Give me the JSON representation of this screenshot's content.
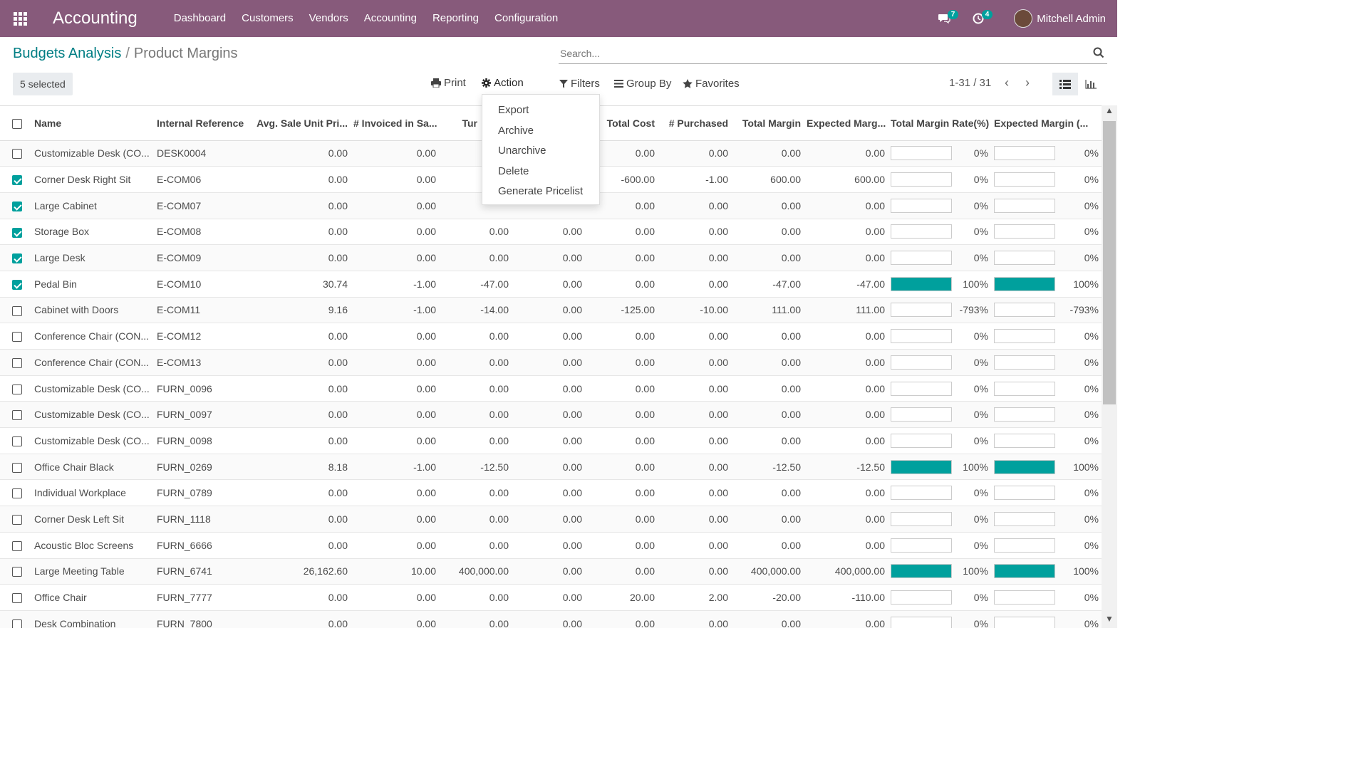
{
  "topbar": {
    "app_title": "Accounting",
    "menu": [
      "Dashboard",
      "Customers",
      "Vendors",
      "Accounting",
      "Reporting",
      "Configuration"
    ],
    "messages_count": "7",
    "activities_count": "4",
    "user_name": "Mitchell Admin"
  },
  "breadcrumb": {
    "parent": "Budgets Analysis",
    "separator": "/",
    "current": "Product Margins"
  },
  "search": {
    "placeholder": "Search..."
  },
  "toolbar": {
    "selected": "5 selected",
    "print": "Print",
    "action": "Action",
    "filters": "Filters",
    "group_by": "Group By",
    "favorites": "Favorites",
    "pager": "1-31 / 31",
    "pager_prev": "‹",
    "pager_next": "›"
  },
  "action_menu": [
    "Export",
    "Archive",
    "Unarchive",
    "Delete",
    "Generate Pricelist"
  ],
  "table": {
    "headers": [
      "Name",
      "Internal Reference",
      "Avg. Sale Unit Pri...",
      "# Invoiced in Sa...",
      "Tur",
      "",
      "Total Cost",
      "# Purchased",
      "Total Margin",
      "Expected Marg...",
      "Total Margin Rate(%)",
      "Expected Margin (..."
    ],
    "rows": [
      {
        "checked": false,
        "name": "Customizable Desk (CO...",
        "ref": "DESK0004",
        "avg": "0.00",
        "inv": "0.00",
        "tur": "",
        "c6": "",
        "cost": "0.00",
        "purch": "0.00",
        "margin": "0.00",
        "exp": "0.00",
        "rate": "0%",
        "rate_fill": 0,
        "exp_rate": "0%",
        "exp_fill": 0
      },
      {
        "checked": true,
        "name": "Corner Desk Right Sit",
        "ref": "E-COM06",
        "avg": "0.00",
        "inv": "0.00",
        "tur": "",
        "c6": "",
        "cost": "-600.00",
        "purch": "-1.00",
        "margin": "600.00",
        "exp": "600.00",
        "rate": "0%",
        "rate_fill": 0,
        "exp_rate": "0%",
        "exp_fill": 0
      },
      {
        "checked": true,
        "name": "Large Cabinet",
        "ref": "E-COM07",
        "avg": "0.00",
        "inv": "0.00",
        "tur": "",
        "c6": "",
        "cost": "0.00",
        "purch": "0.00",
        "margin": "0.00",
        "exp": "0.00",
        "rate": "0%",
        "rate_fill": 0,
        "exp_rate": "0%",
        "exp_fill": 0
      },
      {
        "checked": true,
        "name": "Storage Box",
        "ref": "E-COM08",
        "avg": "0.00",
        "inv": "0.00",
        "tur": "0.00",
        "c6": "0.00",
        "cost": "0.00",
        "purch": "0.00",
        "margin": "0.00",
        "exp": "0.00",
        "rate": "0%",
        "rate_fill": 0,
        "exp_rate": "0%",
        "exp_fill": 0
      },
      {
        "checked": true,
        "name": "Large Desk",
        "ref": "E-COM09",
        "avg": "0.00",
        "inv": "0.00",
        "tur": "0.00",
        "c6": "0.00",
        "cost": "0.00",
        "purch": "0.00",
        "margin": "0.00",
        "exp": "0.00",
        "rate": "0%",
        "rate_fill": 0,
        "exp_rate": "0%",
        "exp_fill": 0
      },
      {
        "checked": true,
        "name": "Pedal Bin",
        "ref": "E-COM10",
        "avg": "30.74",
        "inv": "-1.00",
        "tur": "-47.00",
        "c6": "0.00",
        "cost": "0.00",
        "purch": "0.00",
        "margin": "-47.00",
        "exp": "-47.00",
        "rate": "100%",
        "rate_fill": 1,
        "exp_rate": "100%",
        "exp_fill": 1
      },
      {
        "checked": false,
        "name": "Cabinet with Doors",
        "ref": "E-COM11",
        "avg": "9.16",
        "inv": "-1.00",
        "tur": "-14.00",
        "c6": "0.00",
        "cost": "-125.00",
        "purch": "-10.00",
        "margin": "111.00",
        "exp": "111.00",
        "rate": "-793%",
        "rate_fill": 0,
        "exp_rate": "-793%",
        "exp_fill": 0
      },
      {
        "checked": false,
        "name": "Conference Chair (CON...",
        "ref": "E-COM12",
        "avg": "0.00",
        "inv": "0.00",
        "tur": "0.00",
        "c6": "0.00",
        "cost": "0.00",
        "purch": "0.00",
        "margin": "0.00",
        "exp": "0.00",
        "rate": "0%",
        "rate_fill": 0,
        "exp_rate": "0%",
        "exp_fill": 0
      },
      {
        "checked": false,
        "name": "Conference Chair (CON...",
        "ref": "E-COM13",
        "avg": "0.00",
        "inv": "0.00",
        "tur": "0.00",
        "c6": "0.00",
        "cost": "0.00",
        "purch": "0.00",
        "margin": "0.00",
        "exp": "0.00",
        "rate": "0%",
        "rate_fill": 0,
        "exp_rate": "0%",
        "exp_fill": 0
      },
      {
        "checked": false,
        "name": "Customizable Desk (CO...",
        "ref": "FURN_0096",
        "avg": "0.00",
        "inv": "0.00",
        "tur": "0.00",
        "c6": "0.00",
        "cost": "0.00",
        "purch": "0.00",
        "margin": "0.00",
        "exp": "0.00",
        "rate": "0%",
        "rate_fill": 0,
        "exp_rate": "0%",
        "exp_fill": 0
      },
      {
        "checked": false,
        "name": "Customizable Desk (CO...",
        "ref": "FURN_0097",
        "avg": "0.00",
        "inv": "0.00",
        "tur": "0.00",
        "c6": "0.00",
        "cost": "0.00",
        "purch": "0.00",
        "margin": "0.00",
        "exp": "0.00",
        "rate": "0%",
        "rate_fill": 0,
        "exp_rate": "0%",
        "exp_fill": 0
      },
      {
        "checked": false,
        "name": "Customizable Desk (CO...",
        "ref": "FURN_0098",
        "avg": "0.00",
        "inv": "0.00",
        "tur": "0.00",
        "c6": "0.00",
        "cost": "0.00",
        "purch": "0.00",
        "margin": "0.00",
        "exp": "0.00",
        "rate": "0%",
        "rate_fill": 0,
        "exp_rate": "0%",
        "exp_fill": 0
      },
      {
        "checked": false,
        "name": "Office Chair Black",
        "ref": "FURN_0269",
        "avg": "8.18",
        "inv": "-1.00",
        "tur": "-12.50",
        "c6": "0.00",
        "cost": "0.00",
        "purch": "0.00",
        "margin": "-12.50",
        "exp": "-12.50",
        "rate": "100%",
        "rate_fill": 1,
        "exp_rate": "100%",
        "exp_fill": 1
      },
      {
        "checked": false,
        "name": "Individual Workplace",
        "ref": "FURN_0789",
        "avg": "0.00",
        "inv": "0.00",
        "tur": "0.00",
        "c6": "0.00",
        "cost": "0.00",
        "purch": "0.00",
        "margin": "0.00",
        "exp": "0.00",
        "rate": "0%",
        "rate_fill": 0,
        "exp_rate": "0%",
        "exp_fill": 0
      },
      {
        "checked": false,
        "name": "Corner Desk Left Sit",
        "ref": "FURN_1118",
        "avg": "0.00",
        "inv": "0.00",
        "tur": "0.00",
        "c6": "0.00",
        "cost": "0.00",
        "purch": "0.00",
        "margin": "0.00",
        "exp": "0.00",
        "rate": "0%",
        "rate_fill": 0,
        "exp_rate": "0%",
        "exp_fill": 0
      },
      {
        "checked": false,
        "name": "Acoustic Bloc Screens",
        "ref": "FURN_6666",
        "avg": "0.00",
        "inv": "0.00",
        "tur": "0.00",
        "c6": "0.00",
        "cost": "0.00",
        "purch": "0.00",
        "margin": "0.00",
        "exp": "0.00",
        "rate": "0%",
        "rate_fill": 0,
        "exp_rate": "0%",
        "exp_fill": 0
      },
      {
        "checked": false,
        "name": "Large Meeting Table",
        "ref": "FURN_6741",
        "avg": "26,162.60",
        "inv": "10.00",
        "tur": "400,000.00",
        "c6": "0.00",
        "cost": "0.00",
        "purch": "0.00",
        "margin": "400,000.00",
        "exp": "400,000.00",
        "rate": "100%",
        "rate_fill": 1,
        "exp_rate": "100%",
        "exp_fill": 1
      },
      {
        "checked": false,
        "name": "Office Chair",
        "ref": "FURN_7777",
        "avg": "0.00",
        "inv": "0.00",
        "tur": "0.00",
        "c6": "0.00",
        "cost": "20.00",
        "purch": "2.00",
        "margin": "-20.00",
        "exp": "-110.00",
        "rate": "0%",
        "rate_fill": 0,
        "exp_rate": "0%",
        "exp_fill": 0
      },
      {
        "checked": false,
        "name": "Desk Combination",
        "ref": "FURN_7800",
        "avg": "0.00",
        "inv": "0.00",
        "tur": "0.00",
        "c6": "0.00",
        "cost": "0.00",
        "purch": "0.00",
        "margin": "0.00",
        "exp": "0.00",
        "rate": "0%",
        "rate_fill": 0,
        "exp_rate": "0%",
        "exp_fill": 0
      }
    ]
  },
  "colors": {
    "brand": "#875a7b",
    "accent": "#00a09d",
    "link": "#017e84"
  }
}
